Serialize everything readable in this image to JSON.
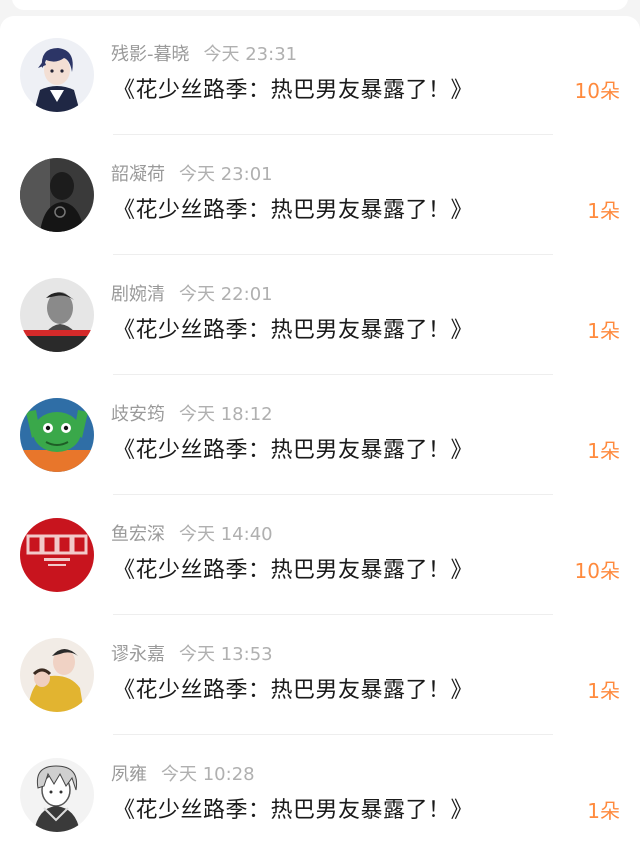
{
  "comments": [
    {
      "name": "残影-暮晓",
      "time": "今天 23:31",
      "text": "《花少丝路季：热巴男友暴露了！》",
      "gift": "10朵",
      "avatar": "anime-boy"
    },
    {
      "name": "韶凝荷",
      "time": "今天 23:01",
      "text": "《花少丝路季：热巴男友暴露了！》",
      "gift": "1朵",
      "avatar": "dark-figure"
    },
    {
      "name": "剧婉清",
      "time": "今天 22:01",
      "text": "《花少丝路季：热巴男友暴露了！》",
      "gift": "1朵",
      "avatar": "bw-portrait"
    },
    {
      "name": "歧安筠",
      "time": "今天 18:12",
      "text": "《花少丝路季：热巴男友暴露了！》",
      "gift": "1朵",
      "avatar": "green-frog"
    },
    {
      "name": "鱼宏深",
      "time": "今天 14:40",
      "text": "《花少丝路季：热巴男友暴露了！》",
      "gift": "10朵",
      "avatar": "red-2020"
    },
    {
      "name": "谬永嘉",
      "time": "今天 13:53",
      "text": "《花少丝路季：热巴男友暴露了！》",
      "gift": "1朵",
      "avatar": "yellow-photo"
    },
    {
      "name": "夙雍",
      "time": "今天 10:28",
      "text": "《花少丝路季：热巴男友暴露了！》",
      "gift": "1朵",
      "avatar": "sketch-character"
    }
  ],
  "colors": {
    "gift": "#ff8a3d",
    "name": "#9a9a9a",
    "title": "#1a1a1a"
  }
}
